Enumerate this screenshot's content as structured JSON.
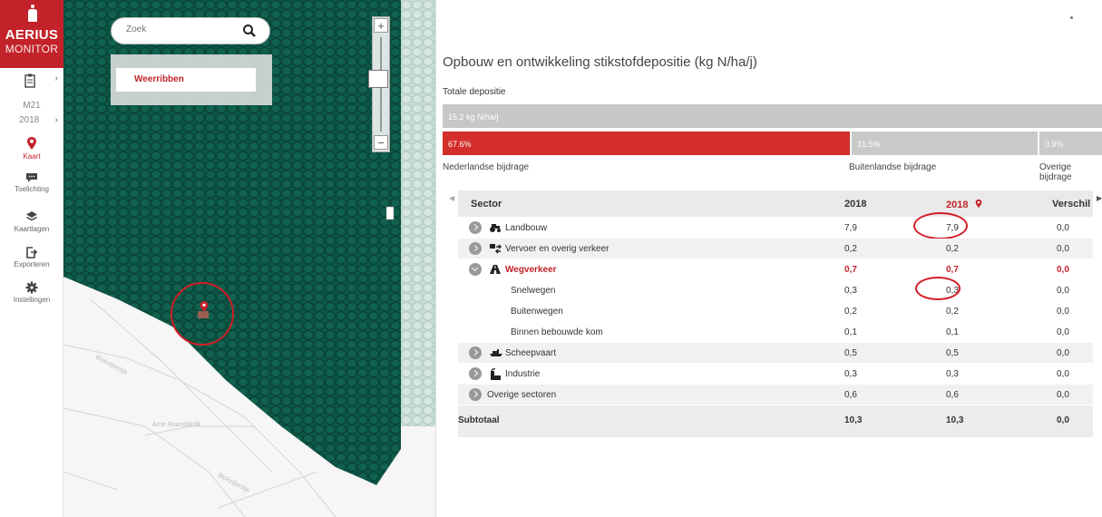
{
  "brand": {
    "name": "AERIUS",
    "sub": "MONITOR",
    "color": "#c3222a"
  },
  "nav": {
    "year_code": "M21",
    "year": "2018",
    "items": [
      {
        "label": "Kaart",
        "icon": "map-pin-icon"
      },
      {
        "label": "Toelichting",
        "icon": "comment-icon"
      },
      {
        "label": "Kaartlagen",
        "icon": "layers-icon"
      },
      {
        "label": "Exporteren",
        "icon": "export-icon"
      },
      {
        "label": "Instellingen",
        "icon": "gear-icon"
      }
    ]
  },
  "map": {
    "search_placeholder": "Zoek",
    "area_name": "Weerribben",
    "hex_color": "#0f5c49",
    "place_labels": [
      "Blokzijlerdijk",
      "Arne Roandskolk",
      "Blokzijlerdijk"
    ]
  },
  "panel": {
    "title": "Opbouw en ontwikkeling stikstofdepositie (kg N/ha/j)",
    "total_label": "Totale depositie",
    "total_value": "15,2 kg N/ha/j",
    "segments": [
      {
        "pct": "67.6%",
        "fraction": 0.676,
        "label": "Nederlandse bijdrage",
        "color": "#d42e2b"
      },
      {
        "pct": "31.5%",
        "fraction": 0.315,
        "label": "Buitenlandse bijdrage",
        "color": "#c9c9c9"
      },
      {
        "pct": "0.9%",
        "fraction": 0.009,
        "label": "Overige bijdrage",
        "color": "#c9c9c9"
      }
    ],
    "table": {
      "headers": {
        "sector": "Sector",
        "y1": "2018",
        "y2": "2018",
        "diff": "Verschil"
      },
      "rows": [
        {
          "label": "Landbouw",
          "y1": "7,9",
          "y2": "7,9",
          "diff": "0,0",
          "icon": "tractor-icon"
        },
        {
          "label": "Vervoer en overig verkeer",
          "y1": "0,2",
          "y2": "0,2",
          "diff": "0,0",
          "icon": "transport-icon"
        },
        {
          "label": "Wegverkeer",
          "y1": "0,7",
          "y2": "0,7",
          "diff": "0,0",
          "icon": "road-icon"
        },
        {
          "label": "Snelwegen",
          "y1": "0,3",
          "y2": "0,3",
          "diff": "0,0"
        },
        {
          "label": "Buitenwegen",
          "y1": "0,2",
          "y2": "0,2",
          "diff": "0,0"
        },
        {
          "label": "Binnen bebouwde kom",
          "y1": "0,1",
          "y2": "0,1",
          "diff": "0,0"
        },
        {
          "label": "Scheepvaart",
          "y1": "0,5",
          "y2": "0,5",
          "diff": "0,0",
          "icon": "ship-icon"
        },
        {
          "label": "Industrie",
          "y1": "0,3",
          "y2": "0,3",
          "diff": "0,0",
          "icon": "factory-icon"
        },
        {
          "label": "Overige sectoren",
          "y1": "0,6",
          "y2": "0,6",
          "diff": "0,0"
        }
      ],
      "subtotal": {
        "label": "Subtotaal",
        "y1": "10,3",
        "y2": "10,3",
        "diff": "0,0"
      }
    }
  }
}
